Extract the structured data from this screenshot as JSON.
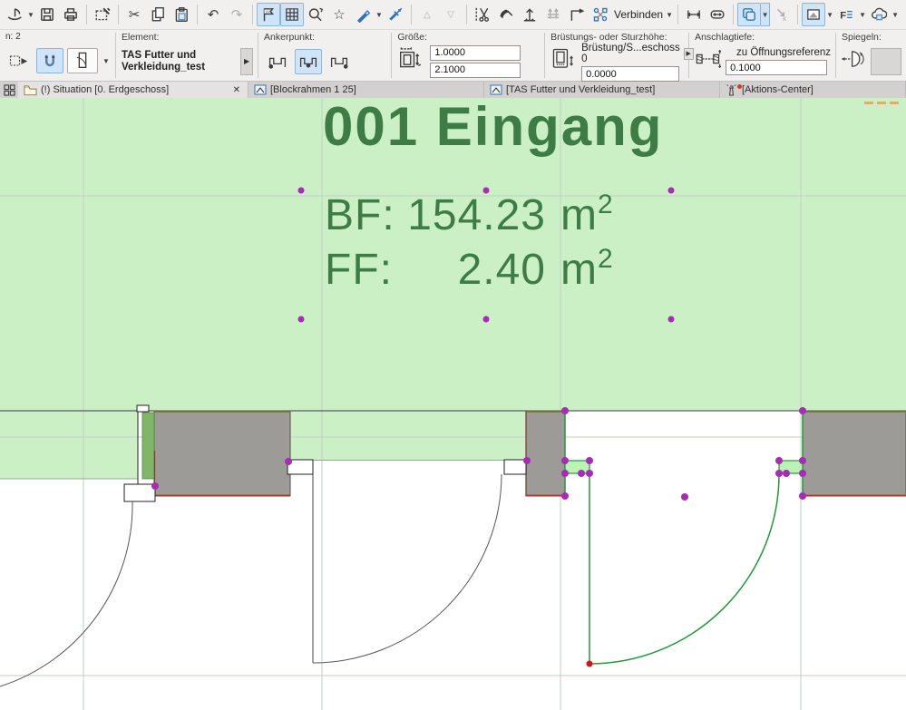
{
  "colors": {
    "canvas-green": "#cbf0c6",
    "room-text": "#3d7c47",
    "wall-gray": "#9d9b97",
    "selection-green": "#21993a",
    "handle-purple": "#a62bb5",
    "active-blue": "#cfe4f6",
    "active-blue-border": "#8ab6dc",
    "toolbar-bg": "#f1f0ee",
    "tabbar-bg": "#d2d1cf",
    "red-edge": "#a93b2e"
  },
  "toolbar": {
    "verbinden_label": "Verbinden",
    "icons": [
      "main-tool",
      "save",
      "print",
      "marquee-pen",
      "cut",
      "copy",
      "paste",
      "undo",
      "redo",
      "flag-xy",
      "grid",
      "zoom-select",
      "favorites-star",
      "pickup-pen",
      "inject-syringe",
      "triangle-up",
      "triangle-down",
      "trim",
      "split-axe",
      "adjust",
      "adjust-alt",
      "l-arrow",
      "connect-nodes",
      "dimension",
      "dimension-alt",
      "duplicate-layers",
      "pick-element",
      "image-view",
      "attribute-list",
      "cloud"
    ]
  },
  "infobar": {
    "stories_label": "n: 2",
    "element": {
      "label": "Element:",
      "value_line1": "TAS Futter und",
      "value_line2": "Verkleidung_test"
    },
    "anchor": {
      "label": "Ankerpunkt:"
    },
    "size": {
      "label": "Größe:",
      "width": "1.0000",
      "height": "2.1000"
    },
    "sill": {
      "label": "Brüstungs- oder Sturzhöhe:",
      "mode": "Brüstung/S...eschoss 0",
      "value": "0.0000"
    },
    "reveal": {
      "label": "Anschlagtiefe:",
      "mode": "zu Öffnungsreferenz",
      "value": "0.1000"
    },
    "mirror": {
      "label": "Spiegeln:"
    }
  },
  "tabs": [
    {
      "label": "(!) Situation [0. Erdgeschoss]",
      "active": true
    },
    {
      "label": "[Blockrahmen 1 25]"
    },
    {
      "label": "[TAS Futter und Verkleidung_test]"
    },
    {
      "label": "[Aktions-Center]"
    }
  ],
  "canvas": {
    "room": {
      "number_name": "001 Eingang",
      "bf_label": "BF:",
      "bf_value": "154.23",
      "ff_label": "FF:",
      "ff_value": "2.40",
      "unit": "m",
      "unit_sup": "2"
    }
  }
}
